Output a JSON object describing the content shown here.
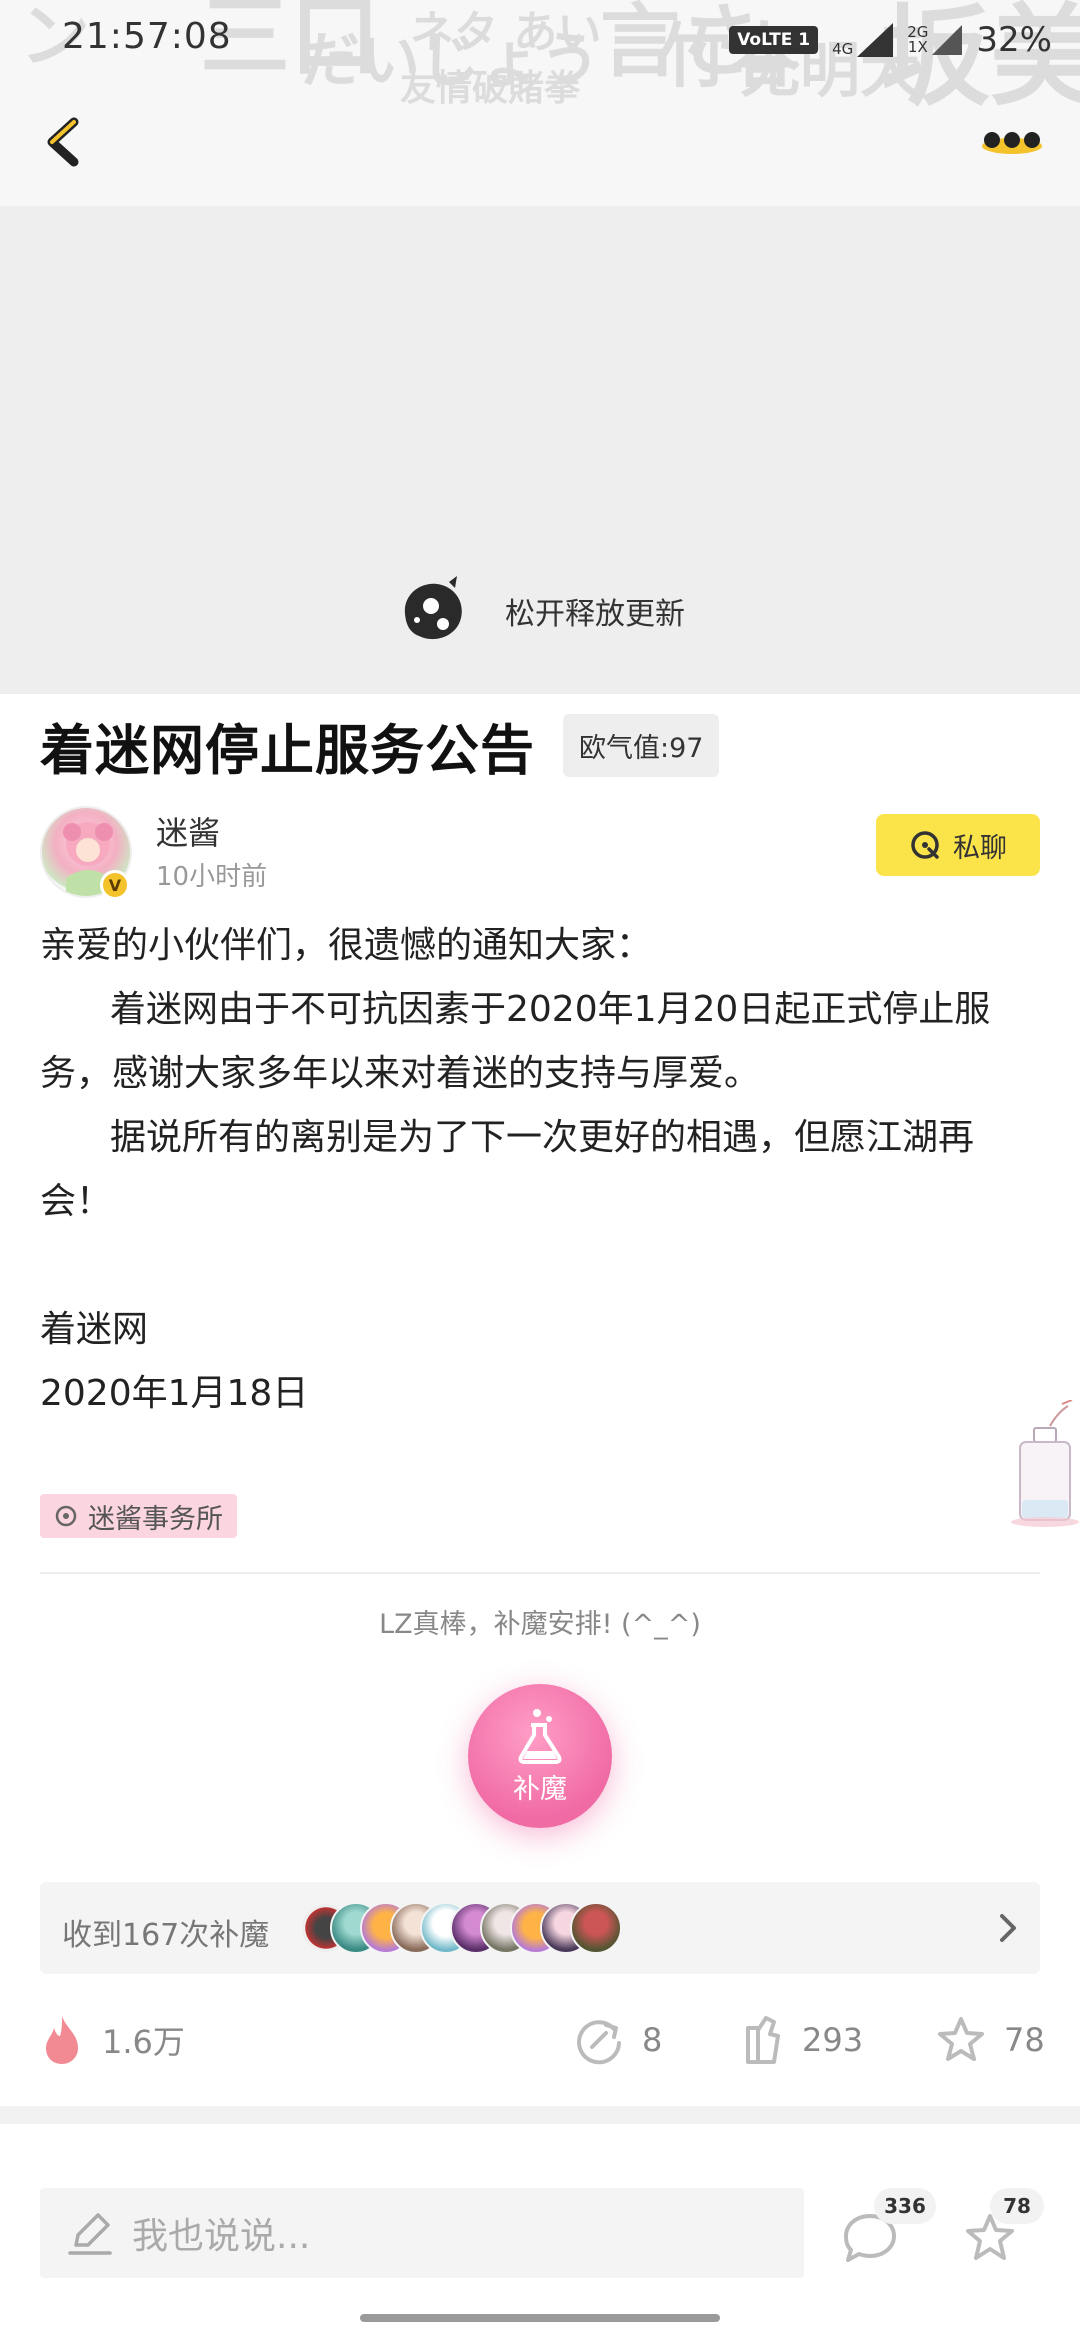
{
  "status_bar": {
    "time": "21:57:08",
    "volte": "VoLTE 1",
    "signal1_label": "4G",
    "signal2_label_top": "2G",
    "signal2_label_bottom": "1X",
    "battery": "32%"
  },
  "refresh": {
    "text": "松开释放更新"
  },
  "post": {
    "title": "着迷网停止服务公告",
    "luck_badge": "欧气值:97",
    "author": {
      "name": "迷酱",
      "time": "10小时前",
      "verified_mark": "V"
    },
    "dm_button": "私聊",
    "body": {
      "line1": "亲爱的小伙伴们，很遗憾的通知大家：",
      "para1": "着迷网由于不可抗因素于2020年1月20日起正式停止服务，感谢大家多年以来对着迷的支持与厚爱。",
      "para2": "据说所有的离别是为了下一次更好的相遇，但愿江湖再会！",
      "signature": "着迷网",
      "date": "2020年1月18日"
    },
    "tag": "迷酱事务所",
    "reward_caption": "LZ真棒，补魔安排! (^_^)",
    "reward_button_label": "补魔",
    "reward_count": "收到167次补魔",
    "stats": {
      "heat": "1.6万",
      "shares": "8",
      "likes": "293",
      "favorites": "78"
    }
  },
  "bottom_bar": {
    "comment_placeholder": "我也说说...",
    "comment_count": "336",
    "favorite_count": "78"
  },
  "colors": {
    "accent_yellow": "#fbe34a",
    "reward_pink": "#f06aa4",
    "tag_pink": "#fbd5e0",
    "heat_red": "#f06a78"
  },
  "icons": [
    "back-icon",
    "more-icon",
    "refresh-mascot-icon",
    "chat-icon",
    "tag-icon",
    "flask-icon",
    "chevron-right-icon",
    "flame-icon",
    "share-icon",
    "like-icon",
    "star-icon",
    "pen-icon",
    "comment-icon"
  ]
}
